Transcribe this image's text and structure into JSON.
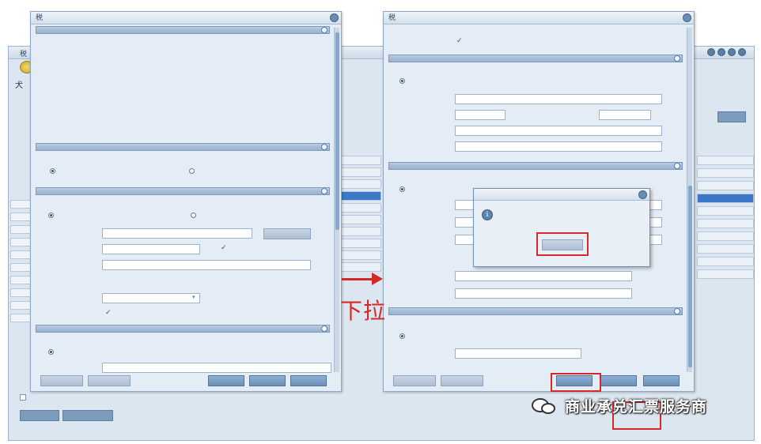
{
  "background": {
    "window_title": "税",
    "side_char": "犬",
    "buttons": [
      "",
      ""
    ],
    "right_list": [
      "",
      "",
      "",
      "",
      "",
      "",
      "",
      "",
      "",
      ""
    ],
    "mid_list": [
      "",
      "",
      "",
      "",
      "",
      "",
      "",
      "",
      "",
      ""
    ]
  },
  "left_dialog": {
    "title": "税",
    "fields": [
      {
        "label": "",
        "value": ""
      },
      {
        "label": "",
        "value": ""
      },
      {
        "label": "",
        "value": ""
      },
      {
        "label": "",
        "value": ""
      },
      {
        "label": "",
        "value": ""
      },
      {
        "label": "",
        "value": ""
      }
    ],
    "section2_header": "",
    "q1_text": "",
    "q1_opt_yes": "",
    "q1_opt_no": "",
    "section3_header": "",
    "q2_text": "",
    "q2_opt_yes": "",
    "q2_opt_no": "",
    "input_a_label": "",
    "input_a_btn": "",
    "input_b_label": "",
    "input_b_check": "",
    "input_c_label": "",
    "input_c_value": "",
    "input_d_label": "",
    "input_d_value": "",
    "select_label": "",
    "select_value": "",
    "bottom_label": "",
    "bottom_check": "",
    "section4_header": "",
    "opt_a": "",
    "opt_b": "",
    "last_label": "",
    "footer_buttons": [
      "",
      "",
      "",
      "",
      ""
    ]
  },
  "right_dialog": {
    "title": "税",
    "top_label": "",
    "top_check": "",
    "section_a_label": "",
    "radio_a": "",
    "radio_a_right": "",
    "row_labels": [
      "",
      "",
      ""
    ],
    "section_b_label": "",
    "radio_b": "",
    "rows_b": [
      "",
      "",
      "",
      ""
    ],
    "row_c1": "",
    "row_c2": "",
    "section_c_label": "",
    "radio_c": "",
    "radio_c_right": "",
    "row_d": "",
    "footer_buttons": [
      "",
      "",
      "",
      "",
      ""
    ]
  },
  "popup": {
    "title": "",
    "message": "",
    "ok_label": ""
  },
  "annotation": {
    "pull_down_text": "下拉"
  },
  "watermark": {
    "text": "商业承兑汇票服务商"
  },
  "colors": {
    "highlight_red": "#d62828",
    "panel_bg": "#e4ecf5",
    "selection_blue": "#3d78c8"
  }
}
